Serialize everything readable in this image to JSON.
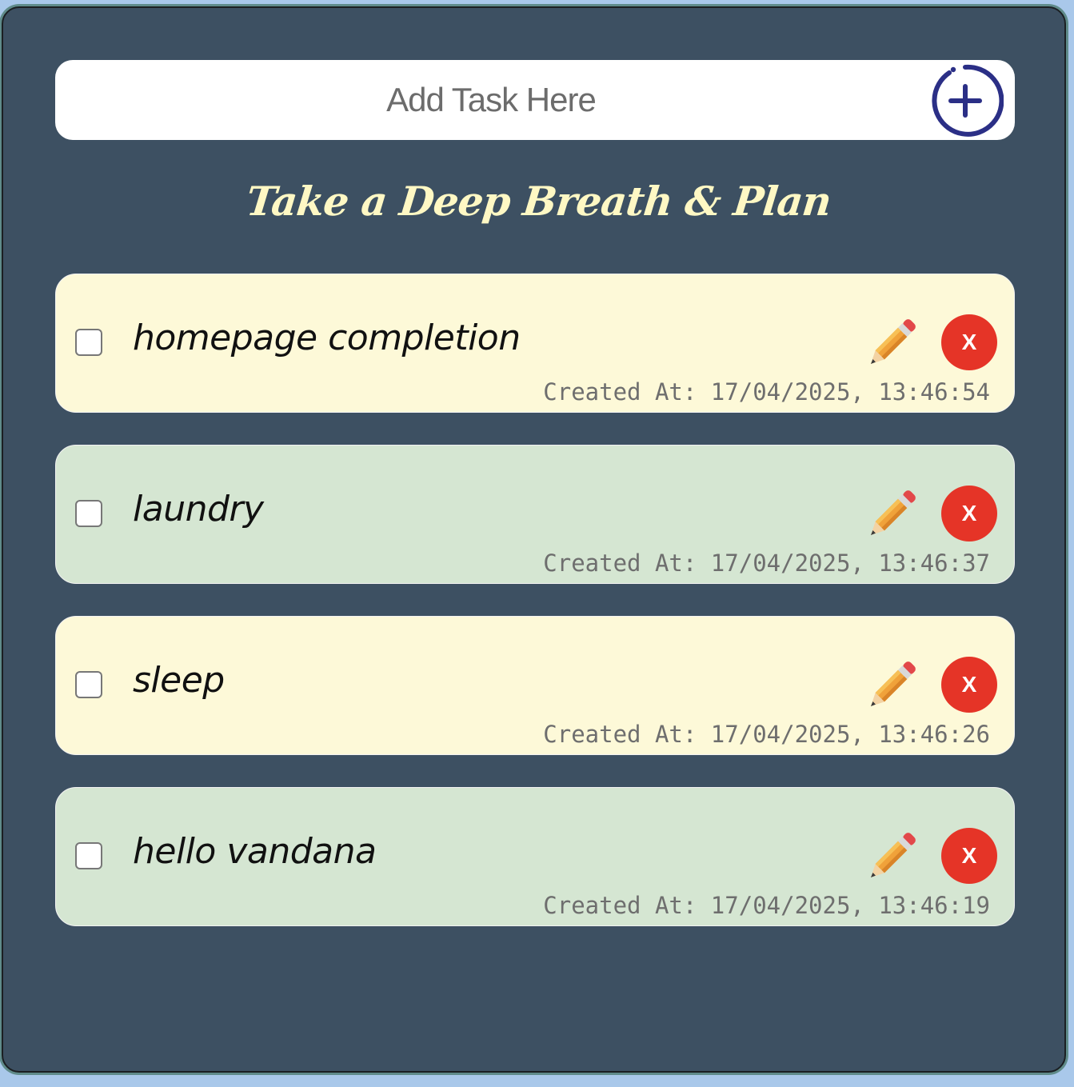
{
  "add_task": {
    "placeholder": "Add Task Here",
    "add_button_icon": "plus-circle-icon",
    "accent_color": "#2b2f86"
  },
  "title": "Take a Deep Breath & Plan",
  "colors": {
    "background": "#3d5062",
    "title": "#fff8c4",
    "card_yellow": "#fdf9d8",
    "card_green": "#d5e6d2",
    "delete": "#e53427"
  },
  "tasks": [
    {
      "text": "homepage completion",
      "created": "Created At: 17/04/2025, 13:46:54",
      "checked": false,
      "color": "#fdf9d8",
      "edit_icon": "pencil-icon",
      "delete_label": "X"
    },
    {
      "text": "laundry",
      "created": "Created At: 17/04/2025, 13:46:37",
      "checked": false,
      "color": "#d5e6d2",
      "edit_icon": "pencil-icon",
      "delete_label": "X"
    },
    {
      "text": "sleep",
      "created": "Created At: 17/04/2025, 13:46:26",
      "checked": false,
      "color": "#fdf9d8",
      "edit_icon": "pencil-icon",
      "delete_label": "X"
    },
    {
      "text": "hello vandana",
      "created": "Created At: 17/04/2025, 13:46:19",
      "checked": false,
      "color": "#d5e6d2",
      "edit_icon": "pencil-icon",
      "delete_label": "X"
    }
  ]
}
